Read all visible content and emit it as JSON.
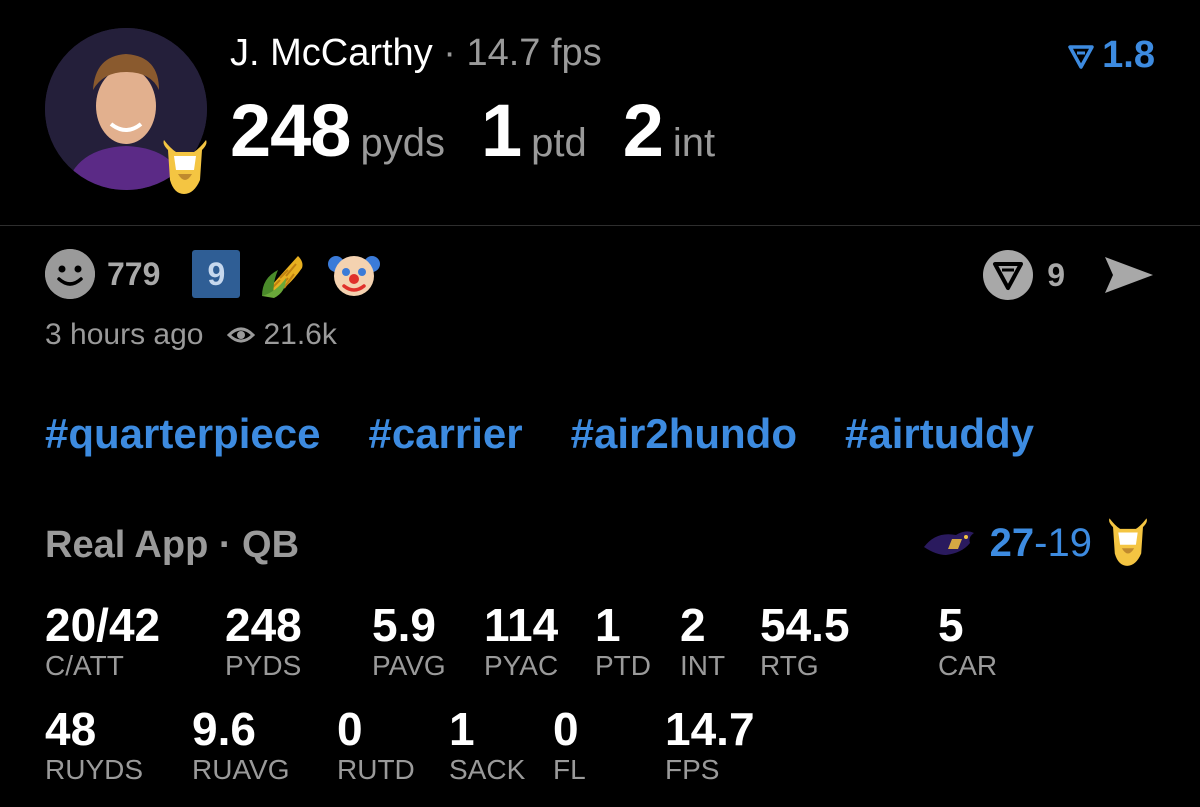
{
  "header": {
    "player_name": "J. McCarthy",
    "separator": "·",
    "fps": "14.7 fps",
    "rating": "1.8",
    "headline_stats": [
      {
        "value": "248",
        "unit": "pyds"
      },
      {
        "value": "1",
        "unit": "ptd"
      },
      {
        "value": "2",
        "unit": "int"
      }
    ],
    "avatar_icon": "player-photo",
    "team_icon": "vikings-logo"
  },
  "reactions": {
    "count": "779",
    "badge": "9",
    "emojis": [
      "corn-emoji",
      "clown-emoji"
    ],
    "replies_count": "9"
  },
  "meta": {
    "time_ago": "3 hours ago",
    "views": "21.6k"
  },
  "tags": [
    "#quarterpiece",
    "#carrier",
    "#air2hundo",
    "#airtuddy"
  ],
  "game": {
    "title": "Real App · QB",
    "score_home": "27",
    "score_dash": "-",
    "score_away": "19",
    "home_icon": "ravens-logo",
    "away_icon": "vikings-logo"
  },
  "stats_row1": [
    {
      "value": "20/42",
      "label": "C/ATT"
    },
    {
      "value": "248",
      "label": "PYDS"
    },
    {
      "value": "5.9",
      "label": "PAVG"
    },
    {
      "value": "114",
      "label": "PYAC"
    },
    {
      "value": "1",
      "label": "PTD"
    },
    {
      "value": "2",
      "label": "INT"
    },
    {
      "value": "54.5",
      "label": "RTG"
    },
    {
      "value": "5",
      "label": "CAR"
    }
  ],
  "stats_row2": [
    {
      "value": "48",
      "label": "RUYDS"
    },
    {
      "value": "9.6",
      "label": "RUAVG"
    },
    {
      "value": "0",
      "label": "RUTD"
    },
    {
      "value": "1",
      "label": "SACK"
    },
    {
      "value": "0",
      "label": "FL"
    },
    {
      "value": "14.7",
      "label": "FPS"
    }
  ],
  "colors": {
    "accent": "#3d8be0",
    "muted": "#9a9a9a",
    "background": "#000000"
  }
}
